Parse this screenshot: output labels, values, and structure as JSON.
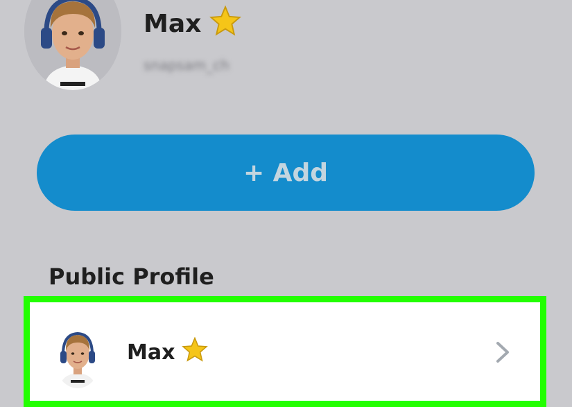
{
  "header": {
    "display_name": "Max",
    "username": "snapsam_ch",
    "name_badge_icon": "star-icon"
  },
  "add_button": {
    "label": "+ Add"
  },
  "public_profile": {
    "section_title": "Public Profile",
    "name": "Max",
    "badge_icon": "star-icon",
    "chevron_icon": "chevron-right-icon"
  },
  "colors": {
    "background": "#c9c9cd",
    "add_button": "#148ccc",
    "highlight": "#22ff00",
    "star": "#f5c518"
  }
}
